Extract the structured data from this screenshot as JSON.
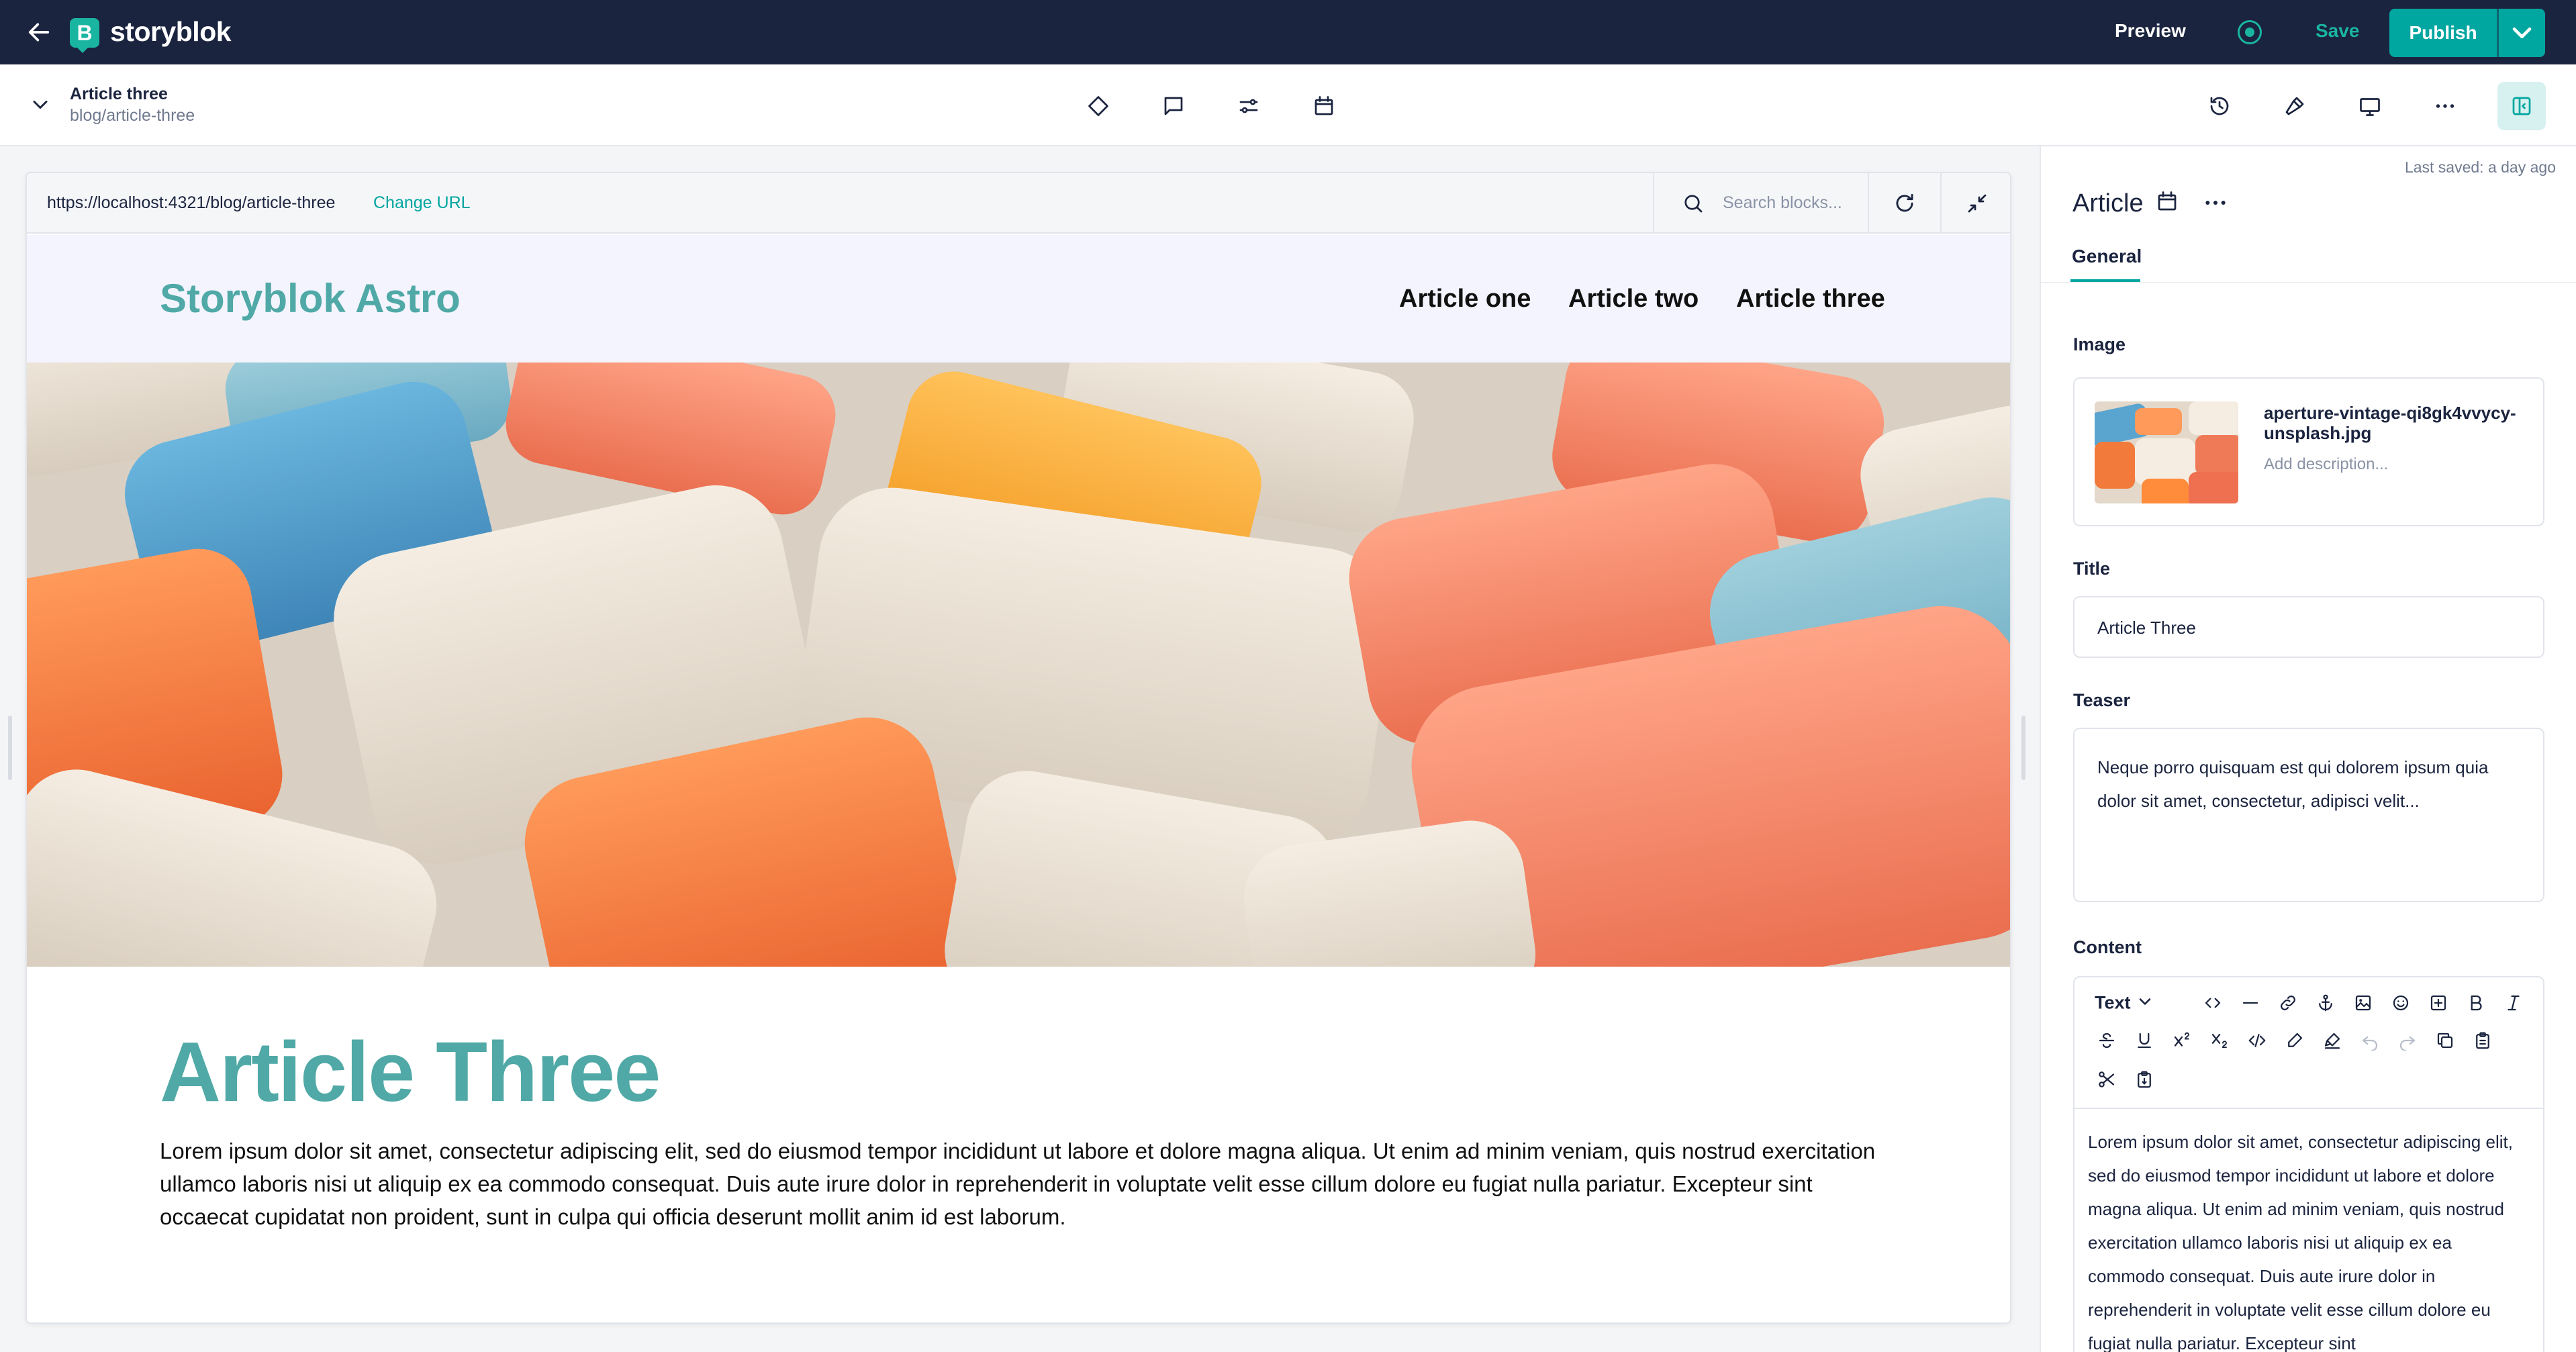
{
  "app": {
    "brand": "storyblok"
  },
  "topbar": {
    "preview_label": "Preview",
    "save_label": "Save",
    "publish_label": "Publish"
  },
  "story": {
    "title": "Article three",
    "slug": "blog/article-three"
  },
  "preview": {
    "url": "https://localhost:4321/blog/article-three",
    "change_url_label": "Change URL",
    "search_placeholder": "Search blocks...",
    "site": {
      "logo": "Storyblok Astro",
      "nav": [
        "Article one",
        "Article two",
        "Article three"
      ]
    },
    "article_title": "Article Three",
    "article_body": "Lorem ipsum dolor sit amet, consectetur adipiscing elit, sed do eiusmod tempor incididunt ut labore et dolore magna aliqua. Ut enim ad minim veniam, quis nostrud exercitation ullamco laboris nisi ut aliquip ex ea commodo consequat. Duis aute irure dolor in reprehenderit in voluptate velit esse cillum dolore eu fugiat nulla pariatur. Excepteur sint occaecat cupidatat non proident, sunt in culpa qui officia deserunt mollit anim id est laborum."
  },
  "panel": {
    "last_saved": "Last saved: a day ago",
    "heading": "Article",
    "tab": "General",
    "image_label": "Image",
    "image_filename": "aperture-vintage-qi8gk4vvycy-unsplash.jpg",
    "image_description_placeholder": "Add description...",
    "title_label": "Title",
    "title_value": "Article Three",
    "teaser_label": "Teaser",
    "teaser_value": "Neque porro quisquam est qui dolorem ipsum quia dolor sit amet, consectetur, adipisci velit...",
    "content_label": "Content",
    "content_text_style": "Text",
    "content_body": "Lorem ipsum dolor sit amet, consectetur adipiscing elit, sed do eiusmod tempor incididunt ut labore et dolore magna aliqua. Ut enim ad minim veniam, quis nostrud exercitation ullamco laboris nisi ut aliquip ex ea commodo consequat. Duis aute irure dolor in reprehenderit in voluptate velit esse cillum dolore eu fugiat nulla pariatur. Excepteur sint"
  },
  "colors": {
    "topbar_bg": "#1b243f",
    "accent": "#00a6a0",
    "site_teal": "#50a9a6"
  }
}
